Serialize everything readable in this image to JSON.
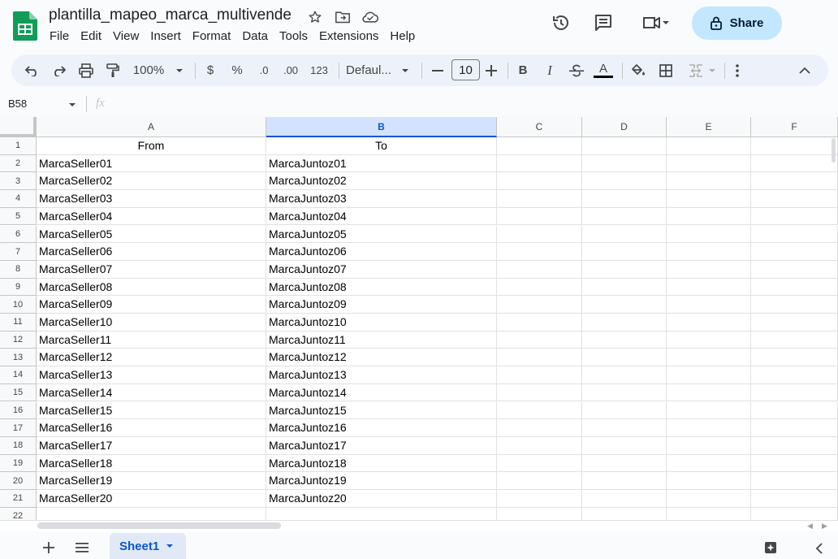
{
  "header": {
    "title": "plantilla_mapeo_marca_multivende",
    "share_label": "Share",
    "menu": [
      "File",
      "Edit",
      "View",
      "Insert",
      "Format",
      "Data",
      "Tools",
      "Extensions",
      "Help"
    ]
  },
  "toolbar": {
    "zoom": "100%",
    "currency": "$",
    "percent": "%",
    "dec_decrease": ".0",
    "dec_increase": ".00",
    "number_format": "123",
    "font": "Defaul...",
    "font_size": "10",
    "bold": "B",
    "italic": "I",
    "text_color_letter": "A"
  },
  "formula_bar": {
    "name_box": "B58",
    "fx": "fx"
  },
  "grid": {
    "columns": [
      "A",
      "B",
      "C",
      "D",
      "E",
      "F"
    ],
    "selected_column": "B",
    "rows": [
      {
        "n": "1",
        "a": "From",
        "b": "To"
      },
      {
        "n": "2",
        "a": "MarcaSeller01",
        "b": "MarcaJuntoz01"
      },
      {
        "n": "3",
        "a": "MarcaSeller02",
        "b": "MarcaJuntoz02"
      },
      {
        "n": "4",
        "a": "MarcaSeller03",
        "b": "MarcaJuntoz03"
      },
      {
        "n": "5",
        "a": "MarcaSeller04",
        "b": "MarcaJuntoz04"
      },
      {
        "n": "6",
        "a": "MarcaSeller05",
        "b": "MarcaJuntoz05"
      },
      {
        "n": "7",
        "a": "MarcaSeller06",
        "b": "MarcaJuntoz06"
      },
      {
        "n": "8",
        "a": "MarcaSeller07",
        "b": "MarcaJuntoz07"
      },
      {
        "n": "9",
        "a": "MarcaSeller08",
        "b": "MarcaJuntoz08"
      },
      {
        "n": "10",
        "a": "MarcaSeller09",
        "b": "MarcaJuntoz09"
      },
      {
        "n": "11",
        "a": "MarcaSeller10",
        "b": "MarcaJuntoz10"
      },
      {
        "n": "12",
        "a": "MarcaSeller11",
        "b": "MarcaJuntoz11"
      },
      {
        "n": "13",
        "a": "MarcaSeller12",
        "b": "MarcaJuntoz12"
      },
      {
        "n": "14",
        "a": "MarcaSeller13",
        "b": "MarcaJuntoz13"
      },
      {
        "n": "15",
        "a": "MarcaSeller14",
        "b": "MarcaJuntoz14"
      },
      {
        "n": "16",
        "a": "MarcaSeller15",
        "b": "MarcaJuntoz15"
      },
      {
        "n": "17",
        "a": "MarcaSeller16",
        "b": "MarcaJuntoz16"
      },
      {
        "n": "18",
        "a": "MarcaSeller17",
        "b": "MarcaJuntoz17"
      },
      {
        "n": "19",
        "a": "MarcaSeller18",
        "b": "MarcaJuntoz18"
      },
      {
        "n": "20",
        "a": "MarcaSeller19",
        "b": "MarcaJuntoz19"
      },
      {
        "n": "21",
        "a": "MarcaSeller20",
        "b": "MarcaJuntoz20"
      },
      {
        "n": "22",
        "a": "",
        "b": ""
      }
    ]
  },
  "sheets": {
    "active": "Sheet1"
  },
  "colors": {
    "accent": "#0b57d0",
    "share_bg": "#c2e7ff",
    "sheets_green": "#0f9d58"
  }
}
